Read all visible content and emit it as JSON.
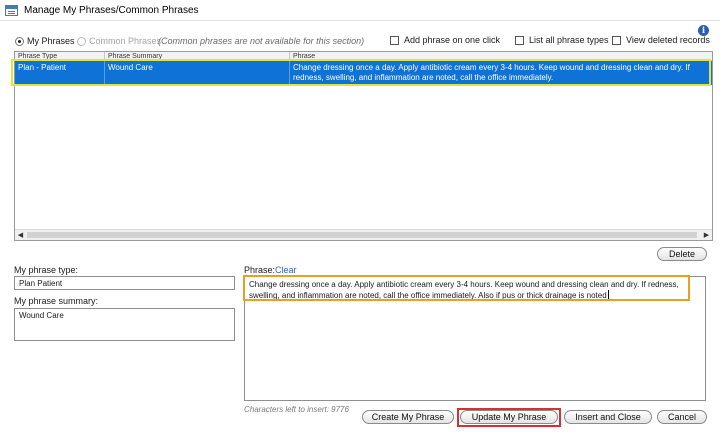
{
  "window": {
    "title": "Manage My Phrases/Common Phrases"
  },
  "source": {
    "my_phrases_label": "My Phrases",
    "common_phrases_label": "Common Phrases",
    "note": "(Common phrases are not available for this section)",
    "selected": "my_phrases"
  },
  "options": {
    "add_on_one_click": "Add phrase on one click",
    "list_all_types": "List all phrase types",
    "view_deleted": "View deleted records"
  },
  "grid": {
    "columns": [
      "Phrase Type",
      "Phrase Summary",
      "Phrase"
    ],
    "rows": [
      {
        "type": "Plan - Patient",
        "summary": "Wound Care",
        "phrase": "Change dressing once a day. Apply antibiotic cream every 3-4 hours. Keep wound and dressing clean and dry. If redness, swelling, and inflammation are noted, call the office immediately."
      }
    ]
  },
  "buttons": {
    "delete": "Delete",
    "create": "Create My Phrase",
    "update": "Update My Phrase",
    "insert_close": "Insert and Close",
    "cancel": "Cancel"
  },
  "form": {
    "type_label": "My phrase type:",
    "type_value": "Plan   Patient",
    "summary_label": "My phrase summary:",
    "summary_value": "Wound Care",
    "phrase_label": "Phrase:",
    "clear_link": "Clear",
    "phrase_value": "Change dressing once a day. Apply antibiotic cream every 3-4 hours. Keep wound and dressing clean and dry. If redness, swelling, and inflammation are noted, call the office immediately. Also if pus or thick drainage is noted",
    "chars_left": "Characters left to insert: 9776"
  },
  "colors": {
    "selection": "#0f72d6",
    "row_highlight": "#e3e33a",
    "phrase_highlight": "#e8a020",
    "update_highlight": "#d63030",
    "link": "#2a66c8"
  }
}
